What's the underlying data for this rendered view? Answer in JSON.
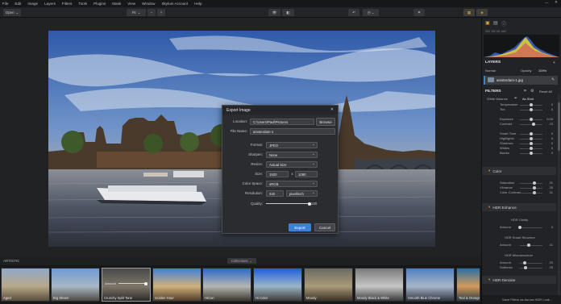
{
  "menu": [
    "File",
    "Edit",
    "Image",
    "Layers",
    "Filters",
    "Tools",
    "Plugins",
    "Mask",
    "View",
    "Window",
    "Skylum Account",
    "Help"
  ],
  "toolbar": {
    "open_label": "Open",
    "zoom_label": "Fit",
    "zoom_minus": "−",
    "zoom_plus": "+"
  },
  "filmstrip": {
    "category": "ARTISTIC",
    "collections_label": "Collections",
    "thumbnails": [
      {
        "label": "Aged"
      },
      {
        "label": "Big Sheen"
      },
      {
        "label": "Crunchy Split Tone",
        "amount_label": "Amount"
      },
      {
        "label": "Golden Hour"
      },
      {
        "label": "HiCon"
      },
      {
        "label": "Hi Color"
      },
      {
        "label": "Moody"
      },
      {
        "label": "Moody Black & White"
      },
      {
        "label": "Smooth Blue Chrome"
      },
      {
        "label": "Teal & Orange"
      }
    ]
  },
  "panel": {
    "histogram_info": "ISO 100  f/8  1/60",
    "layers_title": "LAYERS",
    "blend_mode": "Normal",
    "opacity_label": "Opacity",
    "opacity_value": "100%",
    "layer_name": "amsterdam-1.jpg",
    "filters_title": "FILTERS",
    "reset_all": "Reset All",
    "white_balance": "White Balance",
    "as_shot": "As Shot",
    "basic_rows": [
      {
        "label": "Temperature",
        "value": "0"
      },
      {
        "label": "Tint",
        "value": "0"
      },
      {
        "label": "Exposure",
        "value": "0.00"
      },
      {
        "label": "Contrast",
        "value": "23"
      },
      {
        "label": "Smart Tone",
        "value": "0"
      },
      {
        "label": "Highlights",
        "value": "0"
      },
      {
        "label": "Shadows",
        "value": "0"
      },
      {
        "label": "Whites",
        "value": "0"
      },
      {
        "label": "Blacks",
        "value": "0"
      }
    ],
    "color_section": "Color",
    "color_rows": [
      {
        "label": "Saturation",
        "value": "31"
      },
      {
        "label": "Vibrance",
        "value": "25"
      },
      {
        "label": "Color Contrast",
        "value": "31"
      }
    ],
    "hdr_section": "HDR Enhance",
    "hdr_clarity": "HDR Clarity",
    "hdr_clarity_amount": {
      "label": "Amount",
      "value": "0"
    },
    "hdr_smart": "HDR Smart Structure",
    "hdr_smart_amount": {
      "label": "Amount",
      "value": "41"
    },
    "hdr_micro": "HDR Microstructure",
    "hdr_micro_rows": [
      {
        "label": "Amount",
        "value": "20"
      },
      {
        "label": "Softness",
        "value": "25"
      }
    ],
    "denoise_section": "HDR Denoise",
    "save_filters": "Save Filters as Aurora HDR Look..."
  },
  "dialog": {
    "title": "Export Image",
    "location_label": "Location:",
    "location_value": "C:\\Users\\Paul\\Pictures",
    "browse_label": "Browse",
    "filename_label": "File Name:",
    "filename_value": "amsterdam-1",
    "format_label": "Format:",
    "format_value": "JPEG",
    "sharpen_label": "Sharpen:",
    "sharpen_value": "None",
    "resize_label": "Resize:",
    "resize_value": "Actual Size",
    "size_label": "Size:",
    "size_w": "1920",
    "size_x": "x",
    "size_h": "1080",
    "colorspace_label": "Color Space:",
    "colorspace_value": "sRGB",
    "resolution_label": "Resolution:",
    "resolution_value": "240",
    "resolution_unit": "pixel/inch",
    "quality_label": "Quality:",
    "quality_value": "100",
    "export_label": "Export",
    "cancel_label": "Cancel"
  },
  "colors": {
    "accent_blue": "#3b82d6",
    "section_orange": "#e08a2c"
  }
}
